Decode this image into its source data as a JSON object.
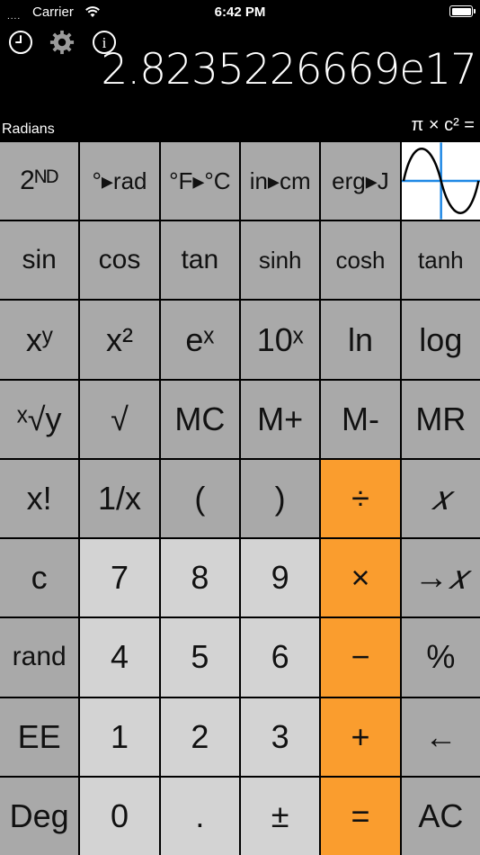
{
  "status": {
    "dots": "....",
    "carrier": "Carrier",
    "time": "6:42 PM"
  },
  "toolbar": {
    "history_icon": "clock-icon",
    "settings_icon": "gear-icon",
    "info_icon": "info-icon",
    "info_glyph": "i"
  },
  "display": {
    "value": "2.8235226669e17"
  },
  "mode": "Radians",
  "memory_expr": "π × c² =",
  "keys": [
    [
      "2ᴺᴰ",
      "°▸rad",
      "°F▸°C",
      "in▸cm",
      "erg▸J",
      "graph"
    ],
    [
      "sin",
      "cos",
      "tan",
      "sinh",
      "cosh",
      "tanh"
    ],
    [
      "xʸ",
      "x²",
      "eˣ",
      "10ˣ",
      "ln",
      "log"
    ],
    [
      "ˣ√y",
      "√",
      "MC",
      "M+",
      "M-",
      "MR"
    ],
    [
      "x!",
      "1/x",
      "(",
      ")",
      "÷",
      "𝑥"
    ],
    [
      "c",
      "7",
      "8",
      "9",
      "×",
      "→𝑥"
    ],
    [
      "rand",
      "4",
      "5",
      "6",
      "−",
      "%"
    ],
    [
      "EE",
      "1",
      "2",
      "3",
      "+",
      "←"
    ],
    [
      "Deg",
      "0",
      ".",
      "±",
      "=",
      "AC"
    ]
  ],
  "colors": {
    "dark_key": "#a9a9a9",
    "light_key": "#d3d3d3",
    "operator_key": "#fa9d2e",
    "graph_axis": "#1e88e5"
  }
}
